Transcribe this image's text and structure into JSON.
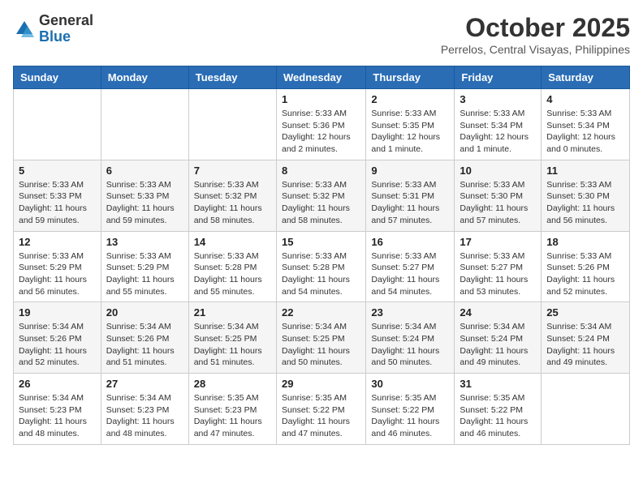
{
  "header": {
    "logo_general": "General",
    "logo_blue": "Blue",
    "month_title": "October 2025",
    "location": "Perrelos, Central Visayas, Philippines"
  },
  "columns": [
    "Sunday",
    "Monday",
    "Tuesday",
    "Wednesday",
    "Thursday",
    "Friday",
    "Saturday"
  ],
  "weeks": [
    [
      {
        "day": "",
        "info": ""
      },
      {
        "day": "",
        "info": ""
      },
      {
        "day": "",
        "info": ""
      },
      {
        "day": "1",
        "info": "Sunrise: 5:33 AM\nSunset: 5:36 PM\nDaylight: 12 hours\nand 2 minutes."
      },
      {
        "day": "2",
        "info": "Sunrise: 5:33 AM\nSunset: 5:35 PM\nDaylight: 12 hours\nand 1 minute."
      },
      {
        "day": "3",
        "info": "Sunrise: 5:33 AM\nSunset: 5:34 PM\nDaylight: 12 hours\nand 1 minute."
      },
      {
        "day": "4",
        "info": "Sunrise: 5:33 AM\nSunset: 5:34 PM\nDaylight: 12 hours\nand 0 minutes."
      }
    ],
    [
      {
        "day": "5",
        "info": "Sunrise: 5:33 AM\nSunset: 5:33 PM\nDaylight: 11 hours\nand 59 minutes."
      },
      {
        "day": "6",
        "info": "Sunrise: 5:33 AM\nSunset: 5:33 PM\nDaylight: 11 hours\nand 59 minutes."
      },
      {
        "day": "7",
        "info": "Sunrise: 5:33 AM\nSunset: 5:32 PM\nDaylight: 11 hours\nand 58 minutes."
      },
      {
        "day": "8",
        "info": "Sunrise: 5:33 AM\nSunset: 5:32 PM\nDaylight: 11 hours\nand 58 minutes."
      },
      {
        "day": "9",
        "info": "Sunrise: 5:33 AM\nSunset: 5:31 PM\nDaylight: 11 hours\nand 57 minutes."
      },
      {
        "day": "10",
        "info": "Sunrise: 5:33 AM\nSunset: 5:30 PM\nDaylight: 11 hours\nand 57 minutes."
      },
      {
        "day": "11",
        "info": "Sunrise: 5:33 AM\nSunset: 5:30 PM\nDaylight: 11 hours\nand 56 minutes."
      }
    ],
    [
      {
        "day": "12",
        "info": "Sunrise: 5:33 AM\nSunset: 5:29 PM\nDaylight: 11 hours\nand 56 minutes."
      },
      {
        "day": "13",
        "info": "Sunrise: 5:33 AM\nSunset: 5:29 PM\nDaylight: 11 hours\nand 55 minutes."
      },
      {
        "day": "14",
        "info": "Sunrise: 5:33 AM\nSunset: 5:28 PM\nDaylight: 11 hours\nand 55 minutes."
      },
      {
        "day": "15",
        "info": "Sunrise: 5:33 AM\nSunset: 5:28 PM\nDaylight: 11 hours\nand 54 minutes."
      },
      {
        "day": "16",
        "info": "Sunrise: 5:33 AM\nSunset: 5:27 PM\nDaylight: 11 hours\nand 54 minutes."
      },
      {
        "day": "17",
        "info": "Sunrise: 5:33 AM\nSunset: 5:27 PM\nDaylight: 11 hours\nand 53 minutes."
      },
      {
        "day": "18",
        "info": "Sunrise: 5:33 AM\nSunset: 5:26 PM\nDaylight: 11 hours\nand 52 minutes."
      }
    ],
    [
      {
        "day": "19",
        "info": "Sunrise: 5:34 AM\nSunset: 5:26 PM\nDaylight: 11 hours\nand 52 minutes."
      },
      {
        "day": "20",
        "info": "Sunrise: 5:34 AM\nSunset: 5:26 PM\nDaylight: 11 hours\nand 51 minutes."
      },
      {
        "day": "21",
        "info": "Sunrise: 5:34 AM\nSunset: 5:25 PM\nDaylight: 11 hours\nand 51 minutes."
      },
      {
        "day": "22",
        "info": "Sunrise: 5:34 AM\nSunset: 5:25 PM\nDaylight: 11 hours\nand 50 minutes."
      },
      {
        "day": "23",
        "info": "Sunrise: 5:34 AM\nSunset: 5:24 PM\nDaylight: 11 hours\nand 50 minutes."
      },
      {
        "day": "24",
        "info": "Sunrise: 5:34 AM\nSunset: 5:24 PM\nDaylight: 11 hours\nand 49 minutes."
      },
      {
        "day": "25",
        "info": "Sunrise: 5:34 AM\nSunset: 5:24 PM\nDaylight: 11 hours\nand 49 minutes."
      }
    ],
    [
      {
        "day": "26",
        "info": "Sunrise: 5:34 AM\nSunset: 5:23 PM\nDaylight: 11 hours\nand 48 minutes."
      },
      {
        "day": "27",
        "info": "Sunrise: 5:34 AM\nSunset: 5:23 PM\nDaylight: 11 hours\nand 48 minutes."
      },
      {
        "day": "28",
        "info": "Sunrise: 5:35 AM\nSunset: 5:23 PM\nDaylight: 11 hours\nand 47 minutes."
      },
      {
        "day": "29",
        "info": "Sunrise: 5:35 AM\nSunset: 5:22 PM\nDaylight: 11 hours\nand 47 minutes."
      },
      {
        "day": "30",
        "info": "Sunrise: 5:35 AM\nSunset: 5:22 PM\nDaylight: 11 hours\nand 46 minutes."
      },
      {
        "day": "31",
        "info": "Sunrise: 5:35 AM\nSunset: 5:22 PM\nDaylight: 11 hours\nand 46 minutes."
      },
      {
        "day": "",
        "info": ""
      }
    ]
  ]
}
